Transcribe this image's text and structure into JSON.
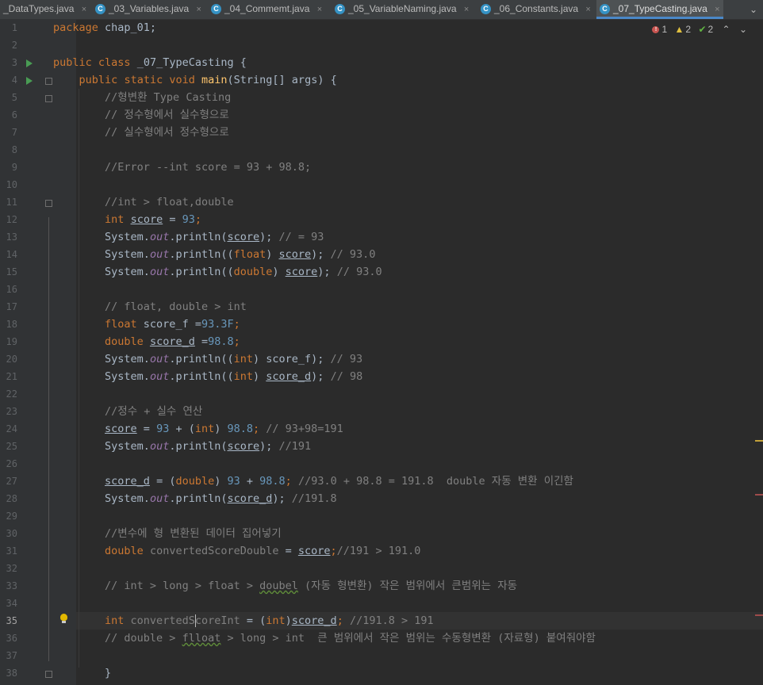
{
  "tabs": [
    {
      "label": "_DataTypes.java",
      "active": false
    },
    {
      "label": "_03_Variables.java",
      "active": false
    },
    {
      "label": "_04_Commemt.java",
      "active": false
    },
    {
      "label": "_05_VariableNaming.java",
      "active": false
    },
    {
      "label": "_06_Constants.java",
      "active": false
    },
    {
      "label": "_07_TypeCasting.java",
      "active": true
    }
  ],
  "tab_icon_glyph": "C",
  "tab_close_glyph": "×",
  "tabs_menu_glyph": "⌄",
  "inspections": {
    "errors": "1",
    "warnings": "2",
    "weak_warnings": "2",
    "up_glyph": "⌃",
    "down_glyph": "⌄"
  },
  "editor": {
    "current_line": "35",
    "line_numbers": [
      "1",
      "2",
      "3",
      "4",
      "5",
      "6",
      "7",
      "8",
      "9",
      "10",
      "11",
      "12",
      "13",
      "14",
      "15",
      "16",
      "17",
      "18",
      "19",
      "20",
      "21",
      "22",
      "23",
      "24",
      "25",
      "26",
      "27",
      "28",
      "29",
      "30",
      "31",
      "32",
      "33",
      "34",
      "35",
      "36",
      "37",
      "38"
    ]
  },
  "icons": {
    "run_lines": [
      "3",
      "4"
    ],
    "fold_lines": [
      "4",
      "5",
      "11",
      "38"
    ],
    "intention_bulb_line": "35"
  },
  "colors": {
    "keyword": "#cc7832",
    "number": "#6897bb",
    "comment": "#808080",
    "method": "#ffc66d",
    "static_field": "#9876aa",
    "plain": "#a9b7c6",
    "background": "#2b2b2b"
  },
  "code": {
    "l1": {
      "kw1": "package",
      "rest": " chap_01;"
    },
    "l3": {
      "kw1": "public",
      "kw2": "class",
      "name": "_07_TypeCasting",
      "rest": " {"
    },
    "l4": {
      "kw1": "public",
      "kw2": "static",
      "kw3": "void",
      "fn": "main",
      "rest": "(String[] args) {"
    },
    "l5": {
      "cm": "//형변환 Type Casting"
    },
    "l6": {
      "cm": "// 정수형에서 실수형으로"
    },
    "l7": {
      "cm": "// 실수형에서 정수형으로"
    },
    "l9": {
      "cm": "//Error --int score = 93 + 98.8;"
    },
    "l11": {
      "cm": "//int > float,double"
    },
    "l12": {
      "kw": "int",
      "var": "score",
      "eq": " = ",
      "num": "93",
      "end": ";"
    },
    "l13": {
      "a": "System.",
      "st": "out",
      "b": ".println(",
      "var": "score",
      "c": "); ",
      "cm": "// = 93"
    },
    "l14": {
      "a": "System.",
      "st": "out",
      "b": ".println((",
      "kw": "float",
      "c": ") ",
      "var": "score",
      "d": "); ",
      "cm": "// 93.0"
    },
    "l15": {
      "a": "System.",
      "st": "out",
      "b": ".println((",
      "kw": "double",
      "c": ") ",
      "var": "score",
      "d": "); ",
      "cm": "// 93.0"
    },
    "l17": {
      "cm": "// float, double > int"
    },
    "l18": {
      "kw": "float",
      "rest": " score_f =",
      "num": "93.3F",
      "end": ";"
    },
    "l19": {
      "kw": "double",
      "var": "score_d",
      "eq": " =",
      "num": "98.8",
      "end": ";"
    },
    "l20": {
      "a": "System.",
      "st": "out",
      "b": ".println((",
      "kw": "int",
      "c": ") score_f); ",
      "cm": "// 93"
    },
    "l21": {
      "a": "System.",
      "st": "out",
      "b": ".println((",
      "kw": "int",
      "c": ") ",
      "var": "score_d",
      "d": "); ",
      "cm": "// 98"
    },
    "l23": {
      "cm": "//정수 + 실수 연산"
    },
    "l24": {
      "var": "score",
      "eq": " = ",
      "num1": "93",
      "b": " + (",
      "kw": "int",
      "c": ") ",
      "num2": "98.8",
      "end": "; ",
      "cm": "// 93+98=191"
    },
    "l25": {
      "a": "System.",
      "st": "out",
      "b": ".println(",
      "var": "score",
      "c": "); ",
      "cm": "//191"
    },
    "l27": {
      "var": "score_d",
      "eq": " = (",
      "kw": "double",
      "c": ") ",
      "num1": "93",
      "plus": " + ",
      "num2": "98.8",
      "end": "; ",
      "cm": "//93.0 + 98.8 = 191.8  double 자동 변환 이긴함"
    },
    "l28": {
      "a": "System.",
      "st": "out",
      "b": ".println(",
      "var": "score_d",
      "c": "); ",
      "cm": "//191.8"
    },
    "l30": {
      "cm": "//변수에 형 변환된 데이터 집어넣기"
    },
    "l31": {
      "kw": "double",
      "name": " convertedScoreDouble",
      "eq": " = ",
      "var": "score",
      "end": ";",
      "cm": "//191 > 191.0"
    },
    "l33": {
      "cm1": "// int > long > float > ",
      "cmw": "doubel",
      "cm2": " (자동 형변환) 작은 범위에서 큰범위는 자동"
    },
    "l35": {
      "kw": "int",
      "name1": " convertedS",
      "name2": "coreInt",
      "eq": " = (",
      "kw2": "int",
      "c": ")",
      "var": "score_d",
      "end": "; ",
      "cm": "//191.8 > 191"
    },
    "l36": {
      "cm1": "// double > ",
      "cmw": "flloat",
      "cm2": " > long > int  큰 범위에서 작은 범위는 수동형변환 (자료형) 붙여줘야함"
    },
    "l38": {
      "rest": "}"
    }
  }
}
